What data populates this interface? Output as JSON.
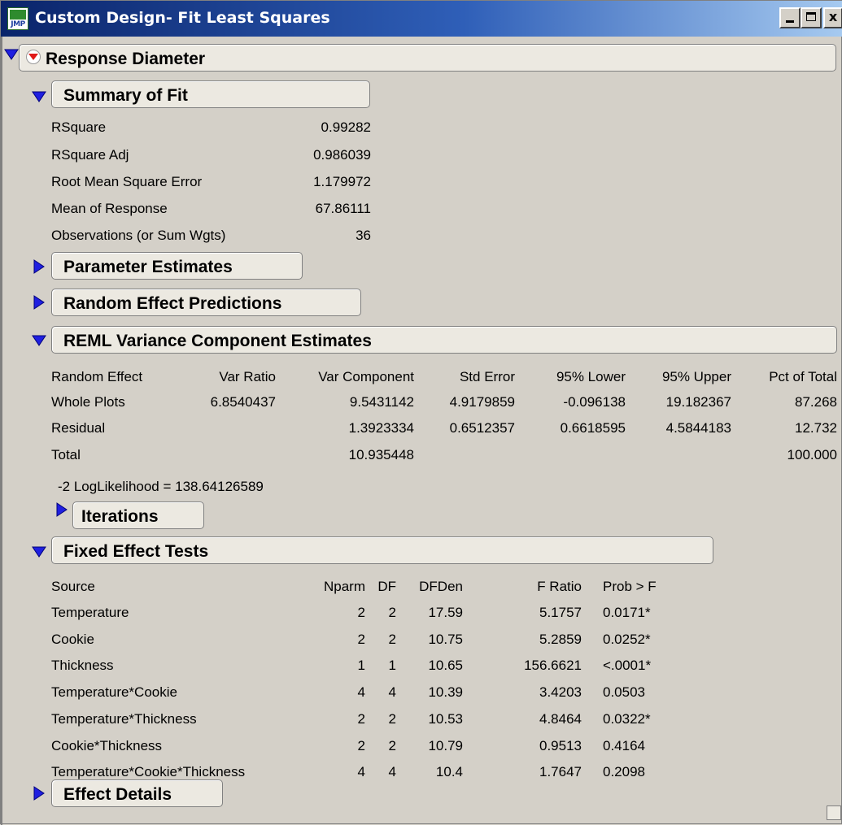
{
  "window": {
    "title": "Custom Design- Fit Least Squares",
    "icon_text": "JMP",
    "icon": "jmp-app-icon",
    "buttons": [
      "minimize-icon",
      "maximize-icon",
      "close-icon"
    ],
    "close_glyph": "x"
  },
  "response": {
    "title": "Response Diameter"
  },
  "summary_of_fit": {
    "title": "Summary of Fit",
    "rows": [
      {
        "label": "RSquare",
        "value": "0.99282"
      },
      {
        "label": "RSquare Adj",
        "value": "0.986039"
      },
      {
        "label": "Root Mean Square Error",
        "value": "1.179972"
      },
      {
        "label": "Mean of Response",
        "value": "67.86111"
      },
      {
        "label": "Observations (or Sum Wgts)",
        "value": "36"
      }
    ]
  },
  "parameter_estimates": {
    "title": "Parameter Estimates"
  },
  "random_effect_predictions": {
    "title": "Random Effect Predictions"
  },
  "reml": {
    "title": "REML Variance Component Estimates",
    "headers": [
      "Random Effect",
      "Var Ratio",
      "Var Component",
      "Std Error",
      "95% Lower",
      "95% Upper",
      "Pct of Total"
    ],
    "rows": [
      [
        "Whole Plots",
        "6.8540437",
        "9.5431142",
        "4.9179859",
        "-0.096138",
        "19.182367",
        "87.268"
      ],
      [
        "Residual",
        "",
        "1.3923334",
        "0.6512357",
        "0.6618595",
        "4.5844183",
        "12.732"
      ],
      [
        "Total",
        "",
        "10.935448",
        "",
        "",
        "",
        "100.000"
      ]
    ],
    "loglik": "-2 LogLikelihood =  138.64126589",
    "iterations_title": "Iterations"
  },
  "fixed_effect_tests": {
    "title": "Fixed Effect Tests",
    "headers": [
      "Source",
      "Nparm",
      "DF",
      "DFDen",
      "F Ratio",
      "Prob > F"
    ],
    "rows": [
      [
        "Temperature",
        "2",
        "2",
        "17.59",
        "5.1757",
        "0.0171*"
      ],
      [
        "Cookie",
        "2",
        "2",
        "10.75",
        "5.2859",
        "0.0252*"
      ],
      [
        "Thickness",
        "1",
        "1",
        "10.65",
        "156.6621",
        "<.0001*"
      ],
      [
        "Temperature*Cookie",
        "4",
        "4",
        "10.39",
        "3.4203",
        "0.0503"
      ],
      [
        "Temperature*Thickness",
        "2",
        "2",
        "10.53",
        "4.8464",
        "0.0322*"
      ],
      [
        "Cookie*Thickness",
        "2",
        "2",
        "10.79",
        "0.9513",
        "0.4164"
      ],
      [
        "Temperature*Cookie*Thickness",
        "4",
        "4",
        "10.4",
        "1.7647",
        "0.2098"
      ]
    ]
  },
  "effect_details": {
    "title": "Effect Details"
  },
  "colors": {
    "titlebar_start": "#0a246a",
    "titlebar_end": "#a6caf0",
    "disclosure_blue": "#1f1fe0",
    "red_button": "#e01818",
    "background": "#d4d0c8"
  }
}
